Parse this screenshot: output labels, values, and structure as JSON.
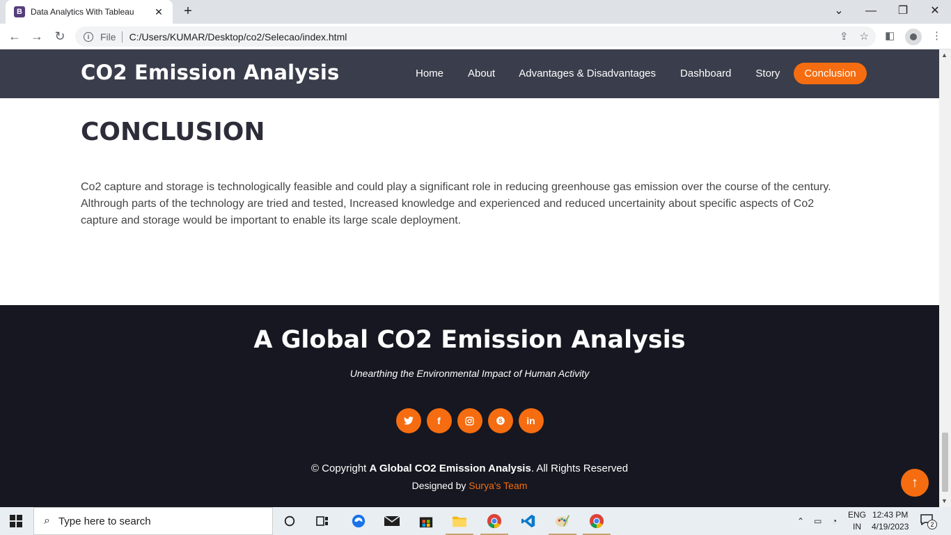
{
  "browser": {
    "tab_title": "Data Analytics With Tableau",
    "tab_favicon": "B",
    "url_scheme": "File",
    "url": "C:/Users/KUMAR/Desktop/co2/Selecao/index.html"
  },
  "site": {
    "logo": "CO2 Emission Analysis",
    "nav": [
      "Home",
      "About",
      "Advantages & Disadvantages",
      "Dashboard",
      "Story"
    ],
    "nav_active": "Conclusion",
    "accent": "#f56d10"
  },
  "conclusion": {
    "title": "CONCLUSION",
    "text": "Co2 capture and storage is technologically feasible and could play a significant role in reducing greenhouse gas emission over the course of the century. Althrough parts of the technology are tried and tested, Increased knowledge and experienced and reduced uncertainity about specific aspects of Co2 capture and storage would be important to enable its large scale deployment."
  },
  "footer": {
    "title": "A Global CO2 Emission Analysis",
    "subtitle": "Unearthing the Environmental Impact of Human Activity",
    "socials": [
      "twitter-icon",
      "facebook-icon",
      "instagram-icon",
      "skype-icon",
      "linkedin-icon"
    ],
    "copyright_prefix": "© Copyright",
    "copyright_brand": "A Global CO2 Emission Analysis",
    "copyright_suffix": ". All Rights Reserved",
    "designed_prefix": "Designed by",
    "designed_team": "Surya's Team"
  },
  "taskbar": {
    "search_placeholder": "Type here to search",
    "lang_top": "ENG",
    "lang_bottom": "IN",
    "time": "12:43 PM",
    "date": "4/19/2023",
    "notification_count": "2"
  }
}
